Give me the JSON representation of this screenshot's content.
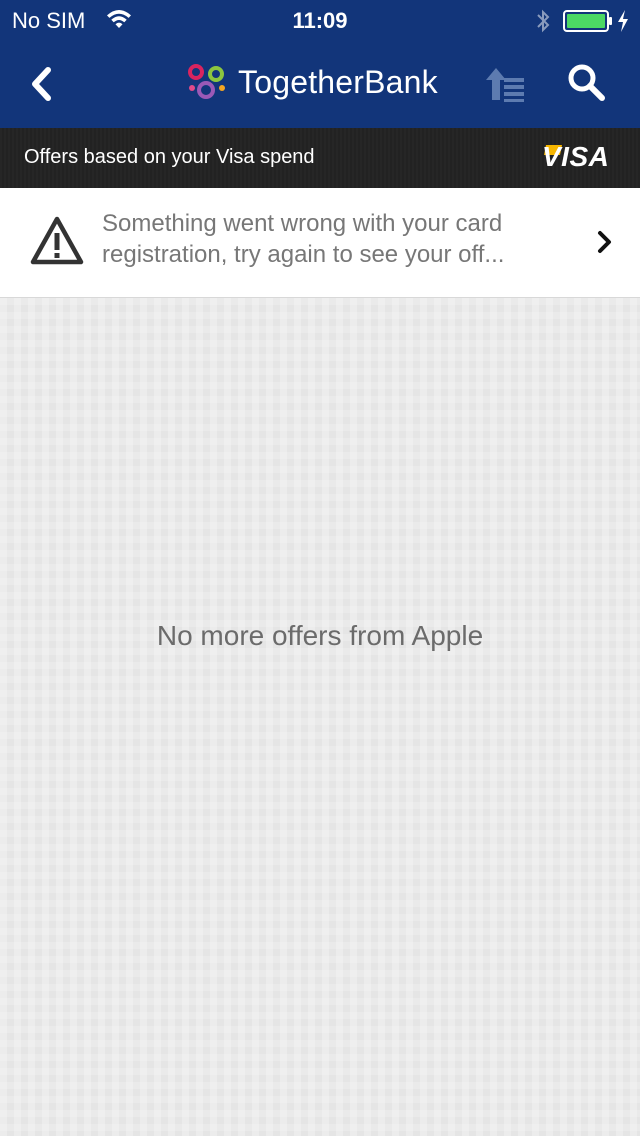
{
  "status": {
    "carrier": "No SIM",
    "time": "11:09",
    "icons": [
      "wifi-icon",
      "bluetooth-icon",
      "battery-icon",
      "charging-icon"
    ]
  },
  "nav": {
    "brand": "TogetherBank",
    "back_icon": "chevron-left-icon",
    "sort_icon": "sort-list-icon",
    "search_icon": "search-icon"
  },
  "visa_strip": {
    "caption": "Offers based on your Visa spend",
    "logo": "VISA"
  },
  "alert": {
    "message": "Something went wrong with your card registration, try again to see your off...",
    "icon": "warning-icon"
  },
  "empty_state": {
    "message": "No more offers from Apple"
  },
  "colors": {
    "nav_background": "#12357a",
    "strip_background": "#222222",
    "visa_flag": "#f7b600",
    "battery": "#4cd964"
  }
}
